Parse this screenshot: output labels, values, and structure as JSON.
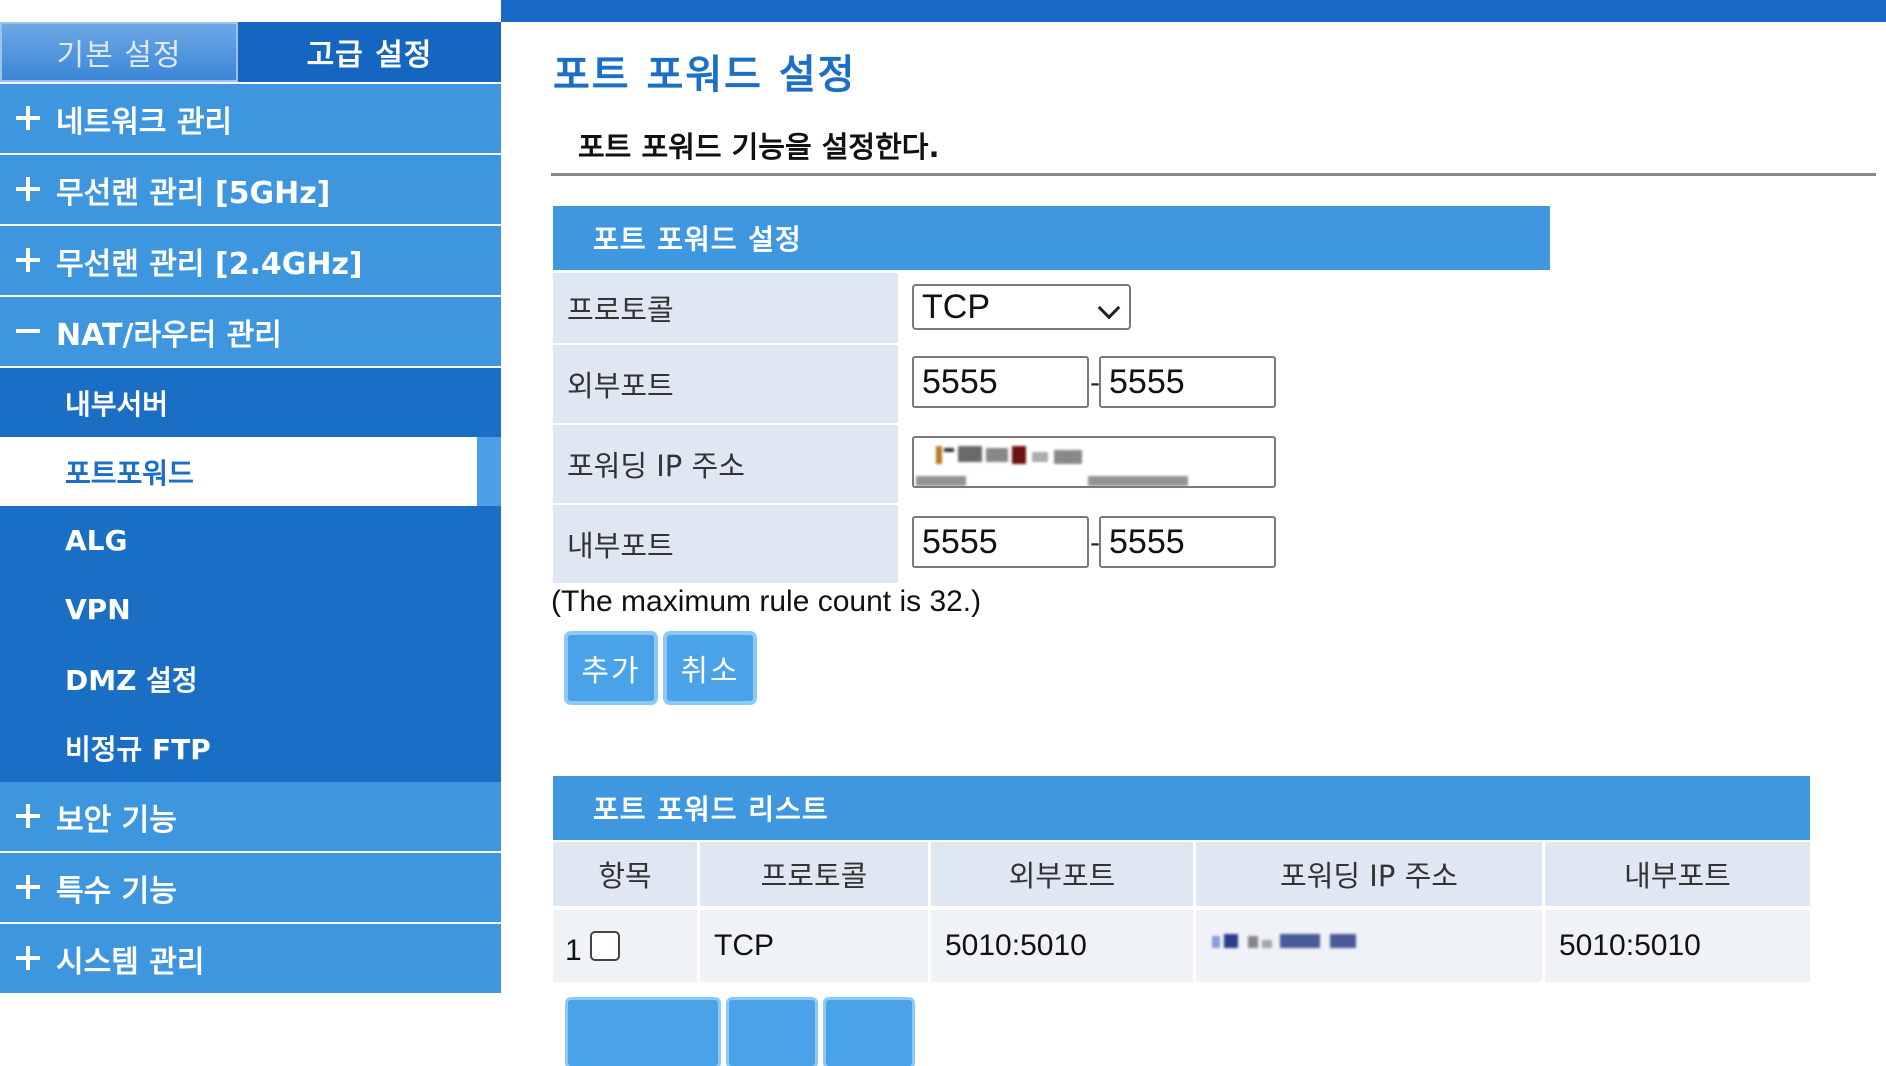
{
  "sidebar": {
    "tabs": {
      "basic": "기본 설정",
      "advanced": "고급 설정"
    },
    "menu": [
      {
        "label": "네트워크 관리",
        "icon": "plus-icon"
      },
      {
        "label": "무선랜 관리 [5GHz]",
        "icon": "plus-icon"
      },
      {
        "label": "무선랜 관리 [2.4GHz]",
        "icon": "plus-icon"
      },
      {
        "label": "NAT/라우터 관리",
        "icon": "minus-icon"
      }
    ],
    "submenu": [
      "내부서버",
      "포트포워드",
      "ALG",
      "VPN",
      "DMZ 설정",
      "비정규 FTP"
    ],
    "active_submenu": "포트포워드",
    "menu_after": [
      {
        "label": "보안 기능",
        "icon": "plus-icon"
      },
      {
        "label": "특수 기능",
        "icon": "plus-icon"
      },
      {
        "label": "시스템 관리",
        "icon": "plus-icon"
      }
    ]
  },
  "page": {
    "title": "포트 포워드 설정",
    "description": "포트 포워드 기능을 설정한다."
  },
  "form": {
    "header": "포트 포워드 설정",
    "protocol_label": "프로토콜",
    "protocol_value": "TCP",
    "external_port_label": "외부포트",
    "external_port_start": "5555",
    "external_port_end": "5555",
    "ip_label": "포워딩 IP 주소",
    "internal_port_label": "내부포트",
    "internal_port_start": "5555",
    "internal_port_end": "5555",
    "separator": "-",
    "note": "(The maximum rule count is 32.)",
    "add_button": "추가",
    "cancel_button": "취소"
  },
  "list": {
    "header": "포트 포워드 리스트",
    "columns": [
      "항목",
      "프로토콜",
      "외부포트",
      "포워딩 IP 주소",
      "내부포트"
    ],
    "rows": [
      {
        "index": "1",
        "protocol": "TCP",
        "external": "5010:5010",
        "internal": "5010:5010"
      }
    ]
  },
  "colors": {
    "accent": "#1b6fc6",
    "sidebar_item": "#3e96df",
    "submenu_bg": "#1a6fc4",
    "label_bg": "#dfe7f2",
    "button": "#4aa2e8"
  }
}
